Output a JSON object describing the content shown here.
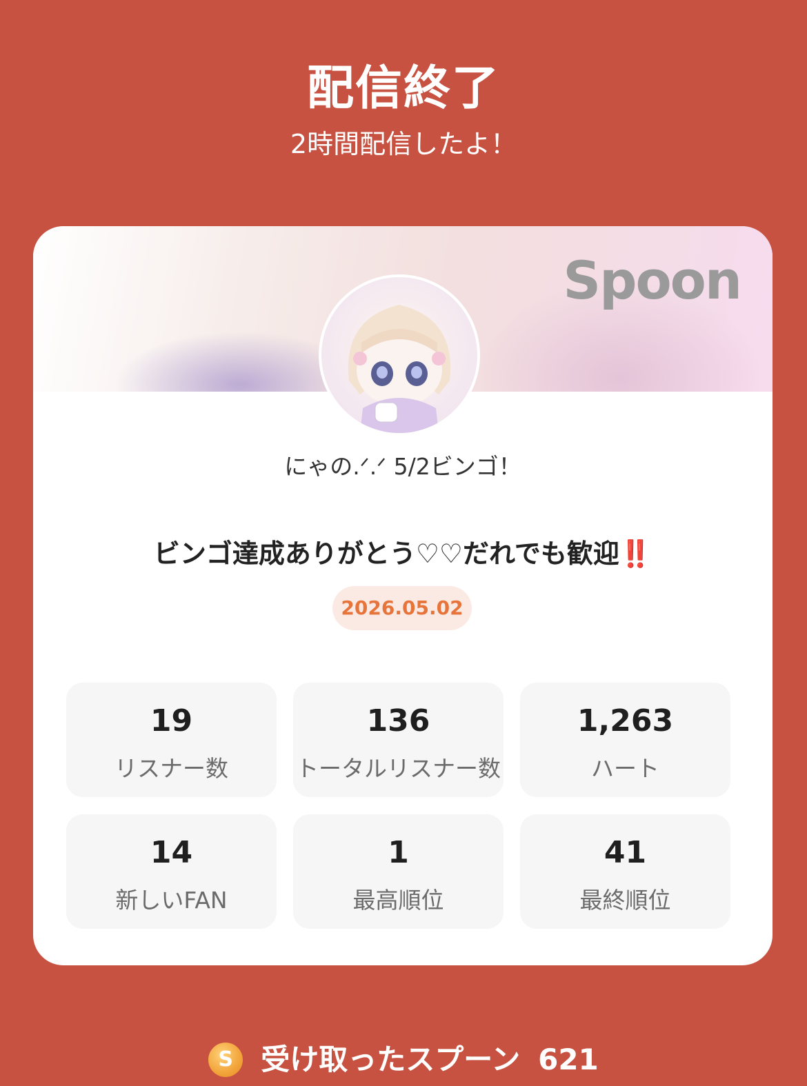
{
  "header": {
    "title": "配信終了",
    "subtitle": "2時間配信したよ！"
  },
  "card": {
    "brand": "Spoon",
    "host_name": "にゃの.ᐟ.ᐟ 5/2ビンゴ！",
    "live_title": "ビンゴ達成ありがとう♡♡だれでも歓迎‼️",
    "date": "2026.05.02",
    "stats": [
      {
        "value": "19",
        "label": "リスナー数"
      },
      {
        "value": "136",
        "label": "トータルリスナー数"
      },
      {
        "value": "1,263",
        "label": "ハート"
      },
      {
        "value": "14",
        "label": "新しいFAN"
      },
      {
        "value": "1",
        "label": "最高順位"
      },
      {
        "value": "41",
        "label": "最終順位"
      }
    ]
  },
  "footer": {
    "coin_icon": "S",
    "label": "受け取ったスプーン",
    "amount": "621"
  },
  "colors": {
    "background": "#c85241",
    "accent_date": "#e6743b",
    "coin": "#f2a43a"
  }
}
